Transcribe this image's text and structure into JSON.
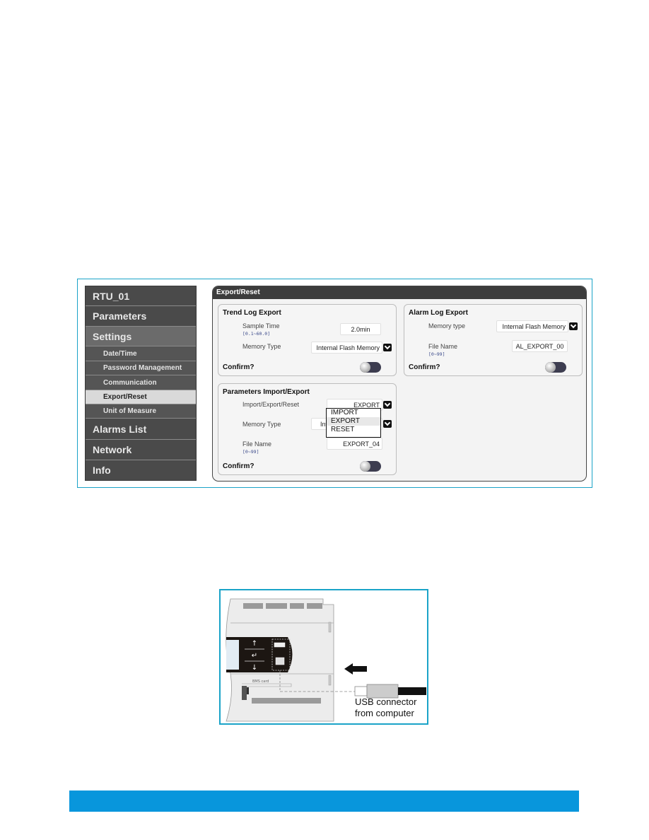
{
  "sidebar": {
    "items": [
      {
        "label": "RTU_01",
        "type": "main"
      },
      {
        "label": "Parameters",
        "type": "main"
      },
      {
        "label": "Settings",
        "type": "main"
      },
      {
        "label": "Date/Time",
        "type": "sub"
      },
      {
        "label": "Password Management",
        "type": "sub"
      },
      {
        "label": "Communication",
        "type": "sub"
      },
      {
        "label": "Export/Reset",
        "type": "sub",
        "active": true
      },
      {
        "label": "Unit of Measure",
        "type": "sub"
      },
      {
        "label": "Alarms List",
        "type": "main"
      },
      {
        "label": "Network",
        "type": "main"
      },
      {
        "label": "Info",
        "type": "main"
      }
    ]
  },
  "panel": {
    "title": "Export/Reset",
    "trend_log": {
      "title": "Trend Log Export",
      "sample_time_label": "Sample Time",
      "sample_time_range": "[0.1~60.0]",
      "sample_time_value": "2.0min",
      "memory_type_label": "Memory Type",
      "memory_type_value": "Internal Flash Memory",
      "confirm_label": "Confirm?",
      "confirm_on": false
    },
    "alarm_log": {
      "title": "Alarm Log Export",
      "memory_type_label": "Memory type",
      "memory_type_value": "Internal Flash Memory",
      "file_name_label": "File Name",
      "file_name_range": "[0~99]",
      "file_name_value": "AL_EXPORT_00",
      "confirm_label": "Confirm?",
      "confirm_on": false
    },
    "params": {
      "title": "Parameters Import/Export",
      "mode_label": "Import/Export/Reset",
      "mode_value": "EXPORT",
      "memory_type_label": "Memory Type",
      "memory_type_value_partial": "Inte",
      "file_name_label": "File Name",
      "file_name_range": "[0~99]",
      "file_name_value": "EXPORT_04",
      "confirm_label": "Confirm?",
      "confirm_on": false,
      "dropdown_options": [
        "IMPORT",
        "EXPORT",
        "RESET"
      ],
      "dropdown_selected": "EXPORT"
    }
  },
  "device_figure": {
    "bms_label": "BMS card",
    "caption_line1": "USB connector",
    "caption_line2": "from computer",
    "keys": [
      "↑",
      "↵",
      "↓"
    ]
  },
  "colors": {
    "frame_border": "#1aa3c8",
    "footer_bar": "#0896dc",
    "sidebar_bg": "#4a4a4a",
    "sidebar_active": "#d9d9d9"
  }
}
